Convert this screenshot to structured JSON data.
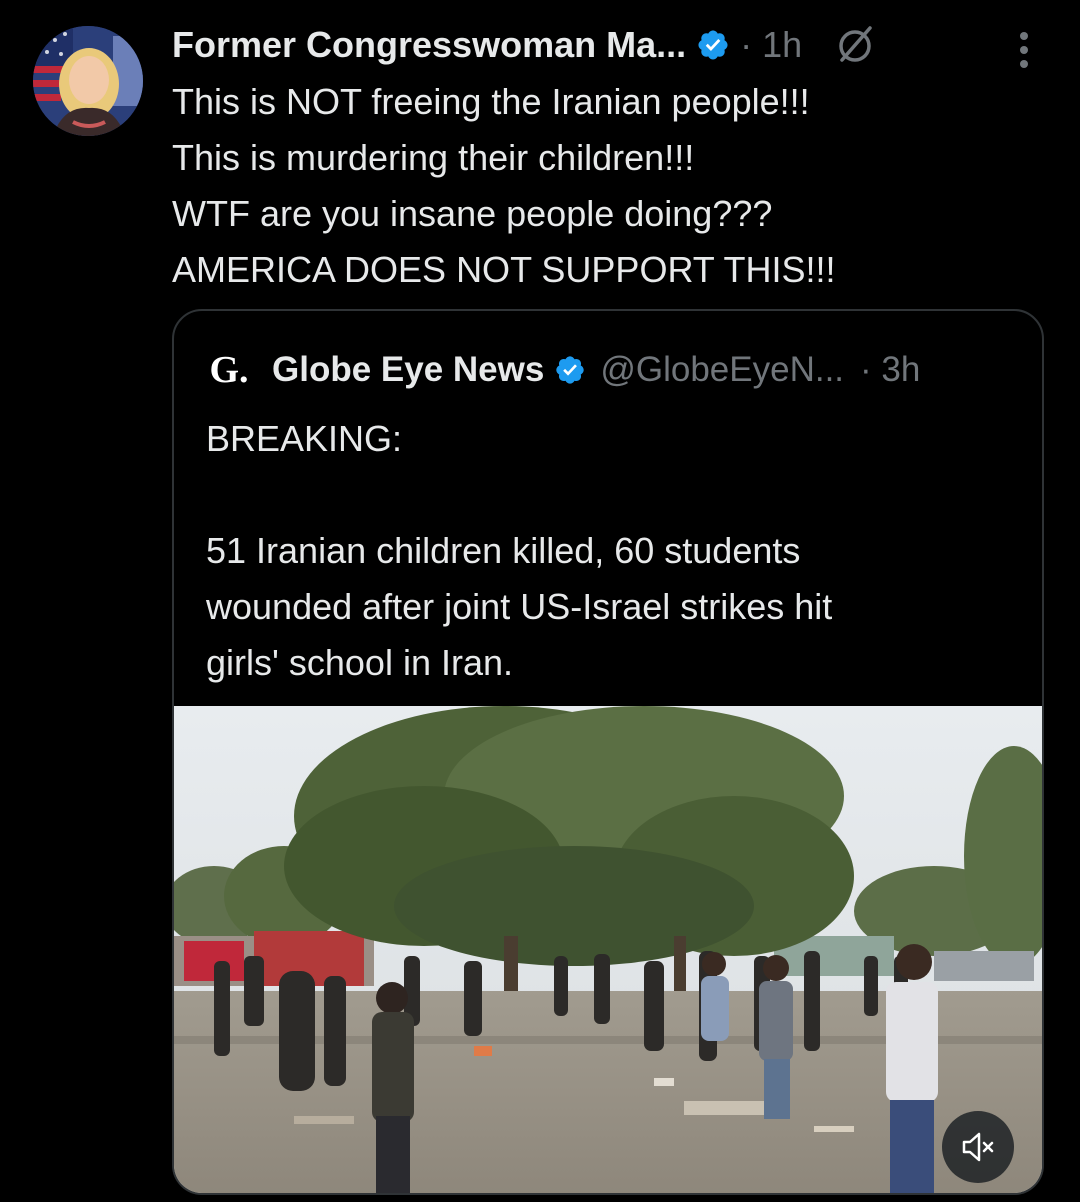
{
  "post": {
    "display_name": "Former Congresswoman Ma...",
    "meta": "· 1h",
    "icons": {
      "verified": "verified-badge-icon",
      "grok": "grok-icon",
      "more": "more-options-icon"
    },
    "text_lines": [
      "This is NOT freeing the Iranian people!!!",
      "This is murdering their children!!!",
      "WTF are you insane people doing???",
      "AMERICA DOES NOT SUPPORT THIS!!!"
    ]
  },
  "quote": {
    "logo_letter": "G.",
    "name": "Globe Eye News",
    "handle": "@GlobeEyeN...",
    "time": "· 3h",
    "text_lines": [
      "BREAKING:",
      "",
      "51 Iranian children killed, 60 students",
      "wounded after joint US-Israel strikes hit",
      "girls' school in Iran."
    ],
    "video": {
      "mute_icon": "volume-muted-icon"
    }
  },
  "colors": {
    "background": "#000000",
    "text_primary": "#e7e9ea",
    "text_secondary": "#71767b",
    "verified_blue": "#1d9bf0",
    "border": "#2f3336"
  }
}
